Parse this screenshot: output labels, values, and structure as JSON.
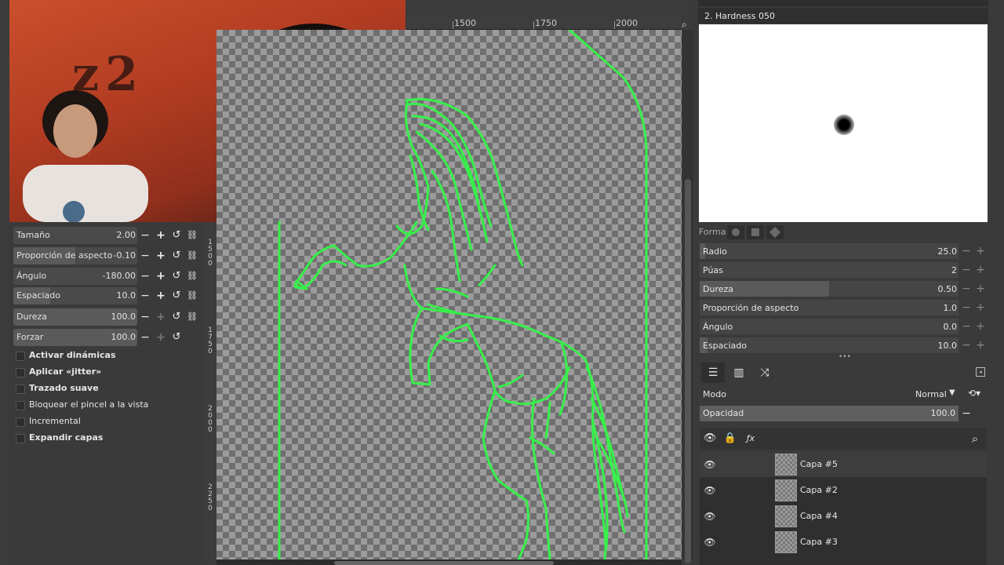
{
  "brush_editor": {
    "title": "2. Hardness 050",
    "shape_label": "Forma:",
    "params": [
      {
        "label": "Radio",
        "value": "25.0",
        "fill": 0.02
      },
      {
        "label": "Púas",
        "value": "2",
        "fill": 0.0
      },
      {
        "label": "Dureza",
        "value": "0.50",
        "fill": 0.5
      },
      {
        "label": "Proporción de aspecto",
        "value": "1.0",
        "fill": 0.0
      },
      {
        "label": "Ángulo",
        "value": "0.0",
        "fill": 0.0
      },
      {
        "label": "Espaciado",
        "value": "10.0",
        "fill": 0.03
      }
    ]
  },
  "tool_options": {
    "sliders": [
      {
        "label": "Tamaño",
        "value": "2.00",
        "fill": 0.0
      },
      {
        "label": "Proporción de aspecto",
        "value": "-0.10",
        "fill": 0.5
      },
      {
        "label": "Ángulo",
        "value": "-180.00",
        "fill": 0.0
      },
      {
        "label": "Espaciado",
        "value": "10.0",
        "fill": 0.3
      },
      {
        "label": "Dureza",
        "value": "100.0",
        "fill": 1.0
      },
      {
        "label": "Forzar",
        "value": "100.0",
        "fill": 1.0
      }
    ],
    "checkboxes": [
      {
        "label": "Activar dinámicas",
        "checked": false
      },
      {
        "label": "Aplicar «jitter»",
        "checked": false
      },
      {
        "label": "Trazado suave",
        "checked": false
      },
      {
        "label": "Bloquear el pincel a la vista",
        "checked": false
      },
      {
        "label": "Incremental",
        "checked": false
      },
      {
        "label": "Expandir capas",
        "checked": false
      }
    ]
  },
  "ruler": {
    "top_labels": [
      "1500",
      "1750",
      "2000"
    ],
    "left_labels": [
      "1500",
      "1750",
      "2000",
      "2250"
    ]
  },
  "layers": {
    "mode_label": "Modo",
    "mode_value": "Normal",
    "opacity_label": "Opacidad",
    "opacity_value": "100.0",
    "items": [
      {
        "name": "Capa #5",
        "visible": true,
        "active": true
      },
      {
        "name": "Capa #2",
        "visible": true,
        "active": false
      },
      {
        "name": "Capa #4",
        "visible": true,
        "active": false
      },
      {
        "name": "Capa #3",
        "visible": true,
        "active": false
      }
    ]
  },
  "colors": {
    "stroke": "#37f04a",
    "panel_bg": "#3a3a3a"
  }
}
